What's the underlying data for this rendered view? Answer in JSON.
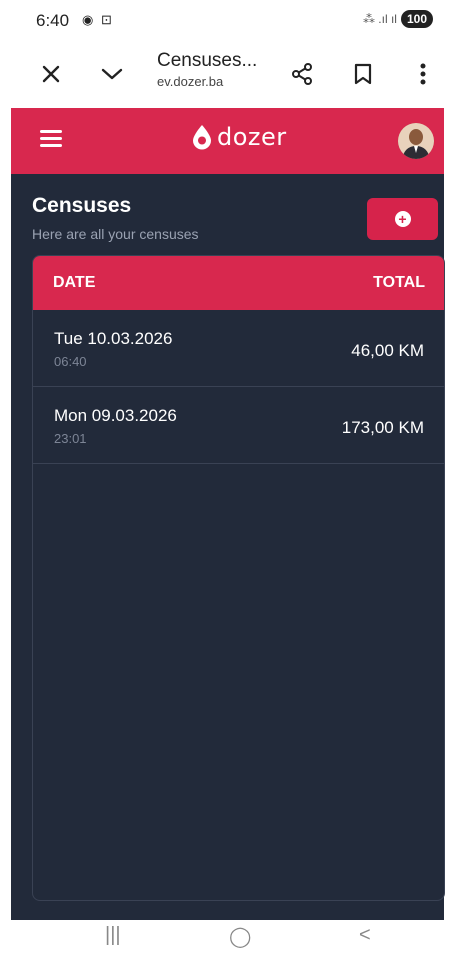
{
  "status": {
    "time": "6:40",
    "icons": "◉ ⊡",
    "signal": "⁂ .ıl ıl",
    "battery": "100"
  },
  "browser": {
    "title": "Censuses...",
    "url": "ev.dozer.ba"
  },
  "app": {
    "logo_text": "dozer"
  },
  "page": {
    "title": "Censuses",
    "subtitle": "Here are all your censuses",
    "columns": {
      "date": "DATE",
      "total": "TOTAL"
    },
    "rows": [
      {
        "date": "Tue 10.03.2026",
        "time": "06:40",
        "total": "46,00 KM"
      },
      {
        "date": "Mon 09.03.2026",
        "time": "23:01",
        "total": "173,00 KM"
      }
    ]
  },
  "nav": {
    "recents": "|||",
    "home": "◯",
    "back": "<"
  },
  "colors": {
    "accent": "#d8284e",
    "background": "#222a3a"
  }
}
